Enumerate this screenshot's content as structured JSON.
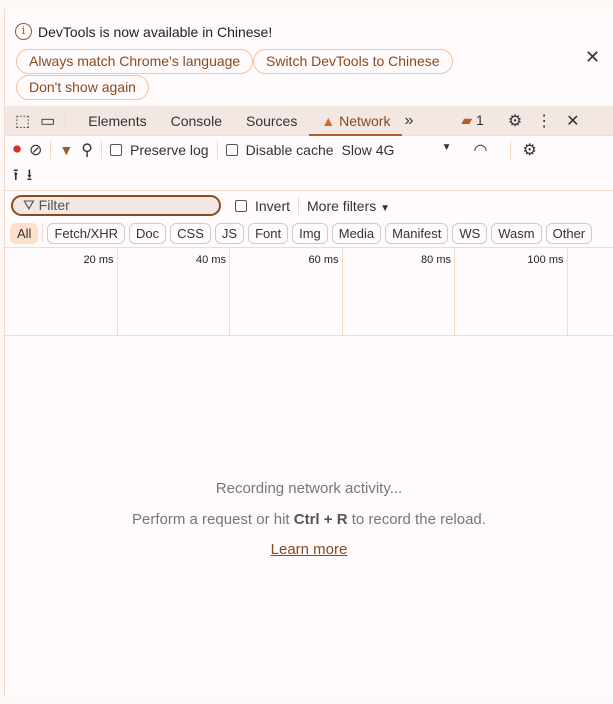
{
  "infobar": {
    "message": "DevTools is now available in Chinese!",
    "buttons": [
      "Always match Chrome's language",
      "Switch DevTools to Chinese",
      "Don't show again"
    ]
  },
  "tabs": [
    "Elements",
    "Console",
    "Sources",
    "Network"
  ],
  "active_tab": "Network",
  "issues_count": "1",
  "toolbar": {
    "preserve_log": "Preserve log",
    "disable_cache": "Disable cache",
    "throttle": "Slow 4G"
  },
  "filter": {
    "placeholder": "Filter",
    "invert": "Invert",
    "more_filters": "More filters"
  },
  "types": [
    "All",
    "Fetch/XHR",
    "Doc",
    "CSS",
    "JS",
    "Font",
    "Img",
    "Media",
    "Manifest",
    "WS",
    "Wasm",
    "Other"
  ],
  "ticks": [
    "20 ms",
    "40 ms",
    "60 ms",
    "80 ms",
    "100 ms"
  ],
  "empty": {
    "line1": "Recording network activity...",
    "line2_pre": "Perform a request or hit ",
    "shortcut": "Ctrl + R",
    "line2_post": " to record the reload.",
    "link": "Learn more"
  },
  "colors": {
    "accent": "#b5602a",
    "record": "#d93025"
  }
}
